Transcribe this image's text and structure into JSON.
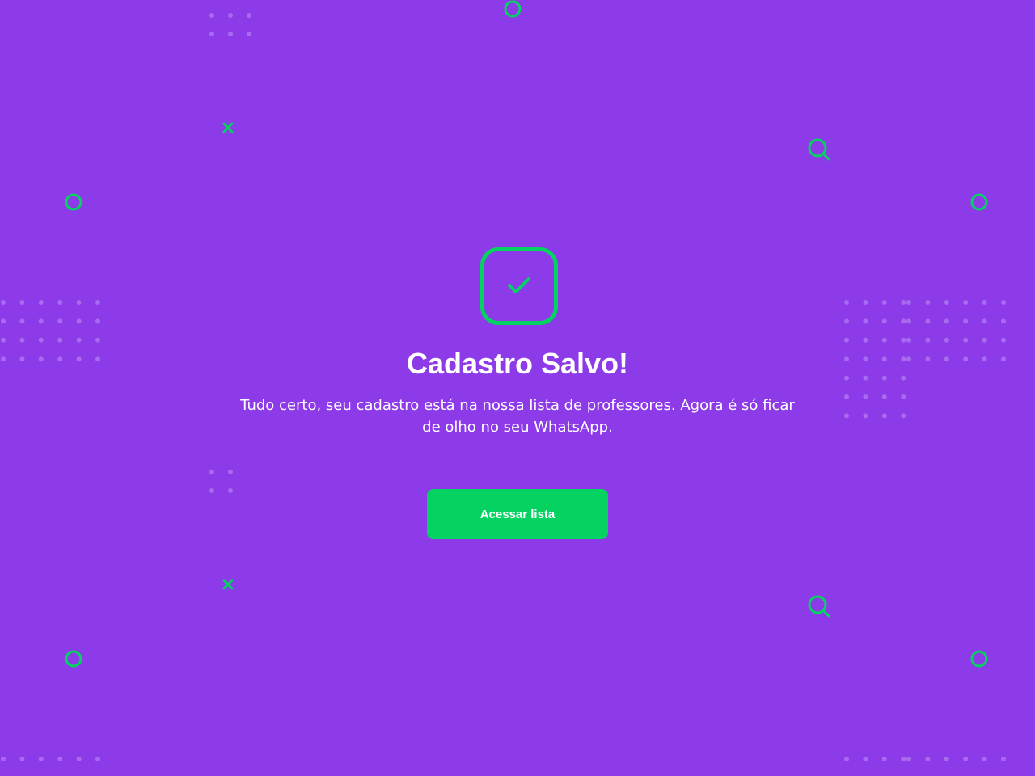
{
  "colors": {
    "background": "#8d3ae8",
    "accent": "#04d361",
    "text": "#ffffff",
    "dots": "#a86aef"
  },
  "success": {
    "icon": "check-icon",
    "title": "Cadastro Salvo!",
    "message": "Tudo certo, seu cadastro está na nossa lista de professores. Agora é só ficar de olho no seu WhatsApp.",
    "button_label": "Acessar lista"
  },
  "decorations": {
    "icons": [
      "circle-outline-icon",
      "close-x-icon",
      "search-icon",
      "dot-grid-pattern"
    ]
  }
}
